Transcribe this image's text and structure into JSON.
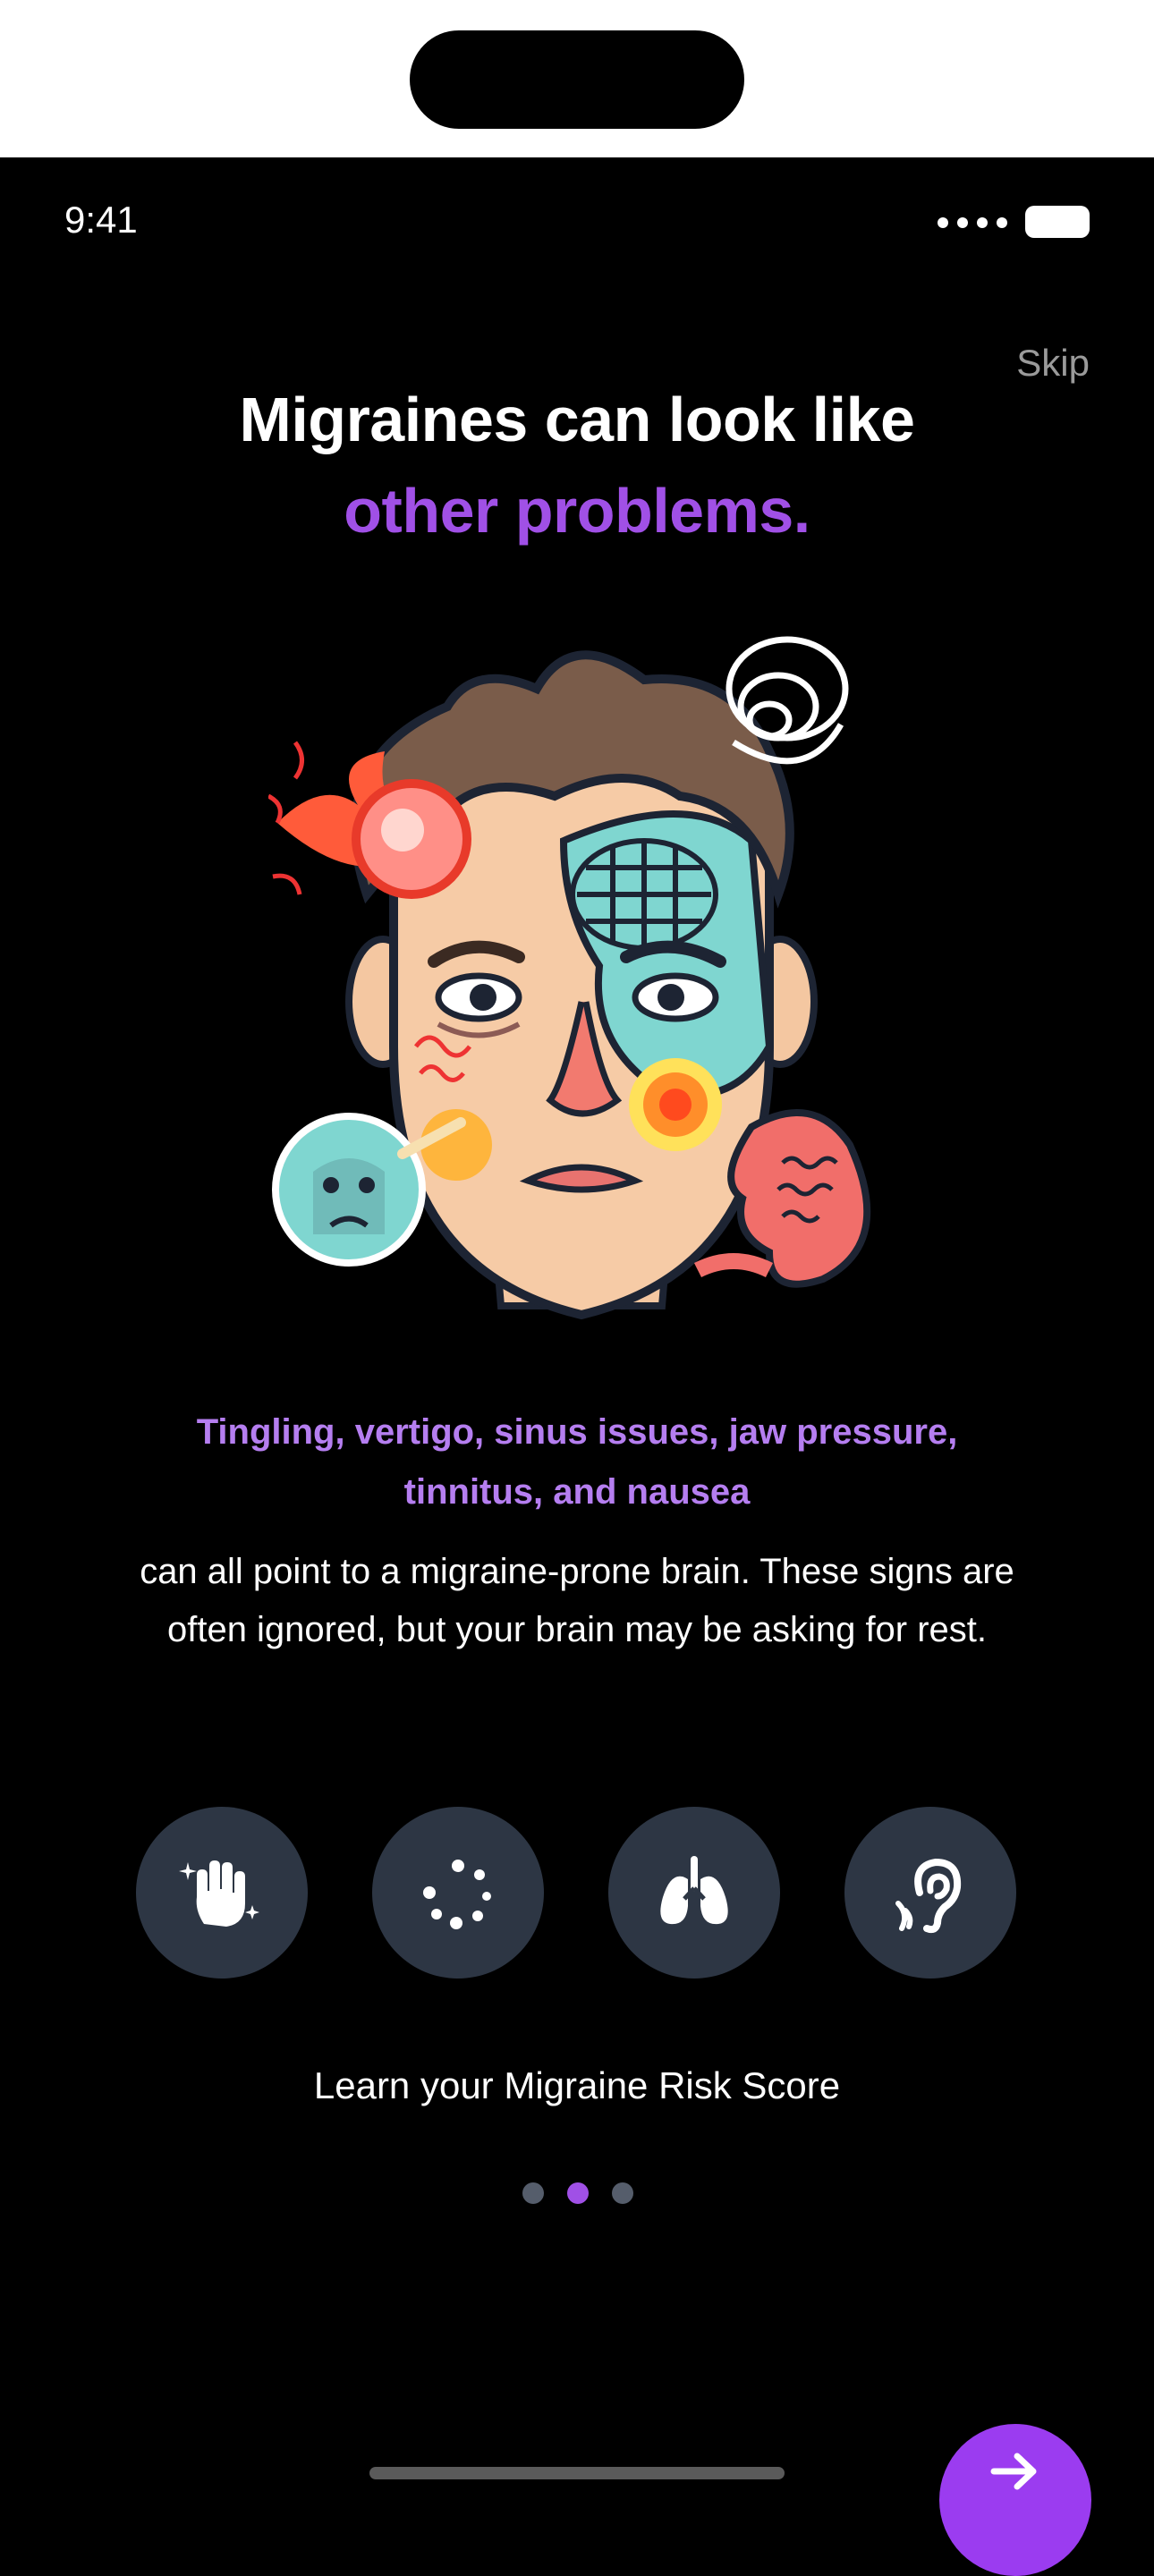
{
  "status_bar": {
    "time": "9:41"
  },
  "header": {
    "skip_label": "Skip"
  },
  "title": {
    "line1": "Migraines can look like",
    "accent": "other problems."
  },
  "illustration": {
    "icon": "migraine-face-illustration"
  },
  "symptoms": {
    "highlight": "Tingling, vertigo, sinus issues, jaw pressure, tinnitus, and nausea"
  },
  "body": {
    "text": "can all point to a migraine-prone brain. These signs are often ignored, but your brain may be asking for rest."
  },
  "symptom_icons": [
    {
      "icon": "tingling-hand-icon"
    },
    {
      "icon": "dizziness-icon"
    },
    {
      "icon": "lungs-icon"
    },
    {
      "icon": "ear-icon"
    }
  ],
  "cta": {
    "label": "Learn your Migraine Risk Score"
  },
  "pager": {
    "count": 3,
    "active_index": 1
  },
  "next_button": {
    "icon": "arrow-right-icon"
  },
  "colors": {
    "accent": "#a050e6",
    "accent_light": "#b57ef0",
    "icon_bg": "#2d3644",
    "background": "#000000"
  }
}
